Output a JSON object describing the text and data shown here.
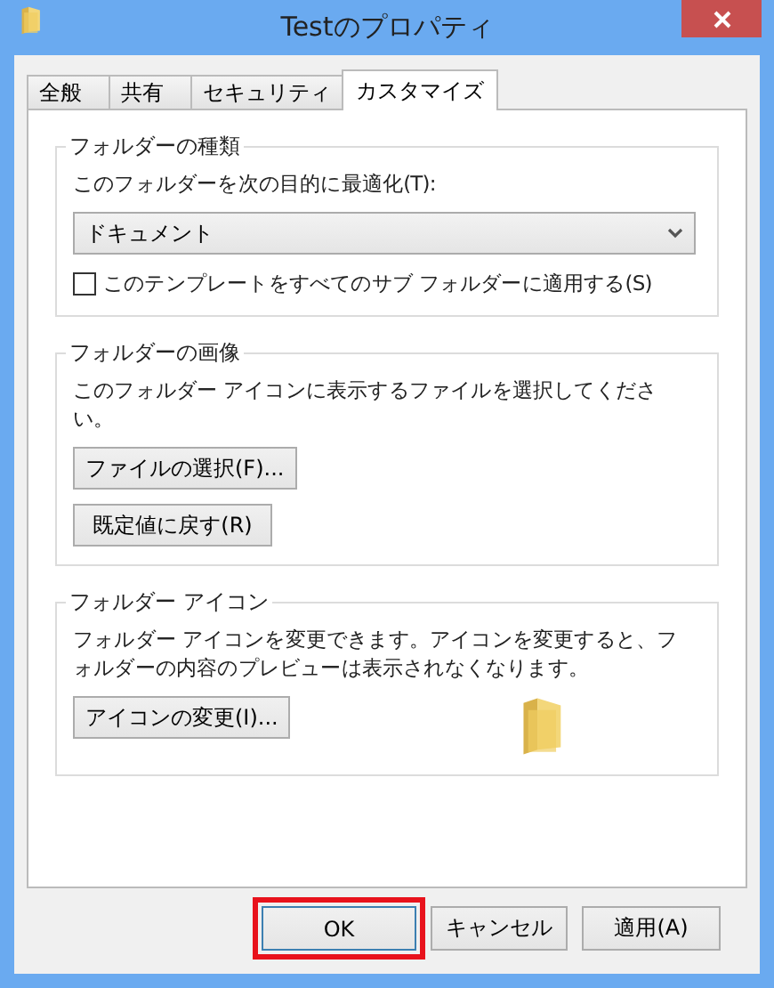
{
  "window": {
    "title": "Testのプロパティ"
  },
  "tabs": [
    {
      "label": "全般",
      "selected": false
    },
    {
      "label": "共有",
      "selected": false
    },
    {
      "label": "セキュリティ",
      "selected": false
    },
    {
      "label": "カスタマイズ",
      "selected": true
    }
  ],
  "groups": [
    {
      "title": "フォルダーの種類",
      "items": [
        {
          "kind": "label",
          "text": "このフォルダーを次の目的に最適化(T):"
        },
        {
          "kind": "dropdown",
          "value": "ドキュメント"
        },
        {
          "kind": "checkbox",
          "text": "このテンプレートをすべてのサブ フォルダーに適用する(S)",
          "checked": false
        }
      ]
    },
    {
      "title": "フォルダーの画像",
      "items": [
        {
          "kind": "label",
          "text": "このフォルダー アイコンに表示するファイルを選択してください。"
        },
        {
          "kind": "button",
          "text": "ファイルの選択(F)..."
        },
        {
          "kind": "button",
          "text": "既定値に戻す(R)"
        }
      ]
    },
    {
      "title": "フォルダー アイコン",
      "items": [
        {
          "kind": "label",
          "text": "フォルダー アイコンを変更できます。アイコンを変更すると、フォルダーの内容のプレビューは表示されなくなります。"
        },
        {
          "kind": "iconbutton",
          "text": "アイコンの変更(I)..."
        }
      ]
    }
  ],
  "buttons": [
    {
      "label": "OK",
      "highlighted": true
    },
    {
      "label": "キャンセル",
      "highlighted": false
    },
    {
      "label": "適用(A)",
      "highlighted": false
    }
  ]
}
